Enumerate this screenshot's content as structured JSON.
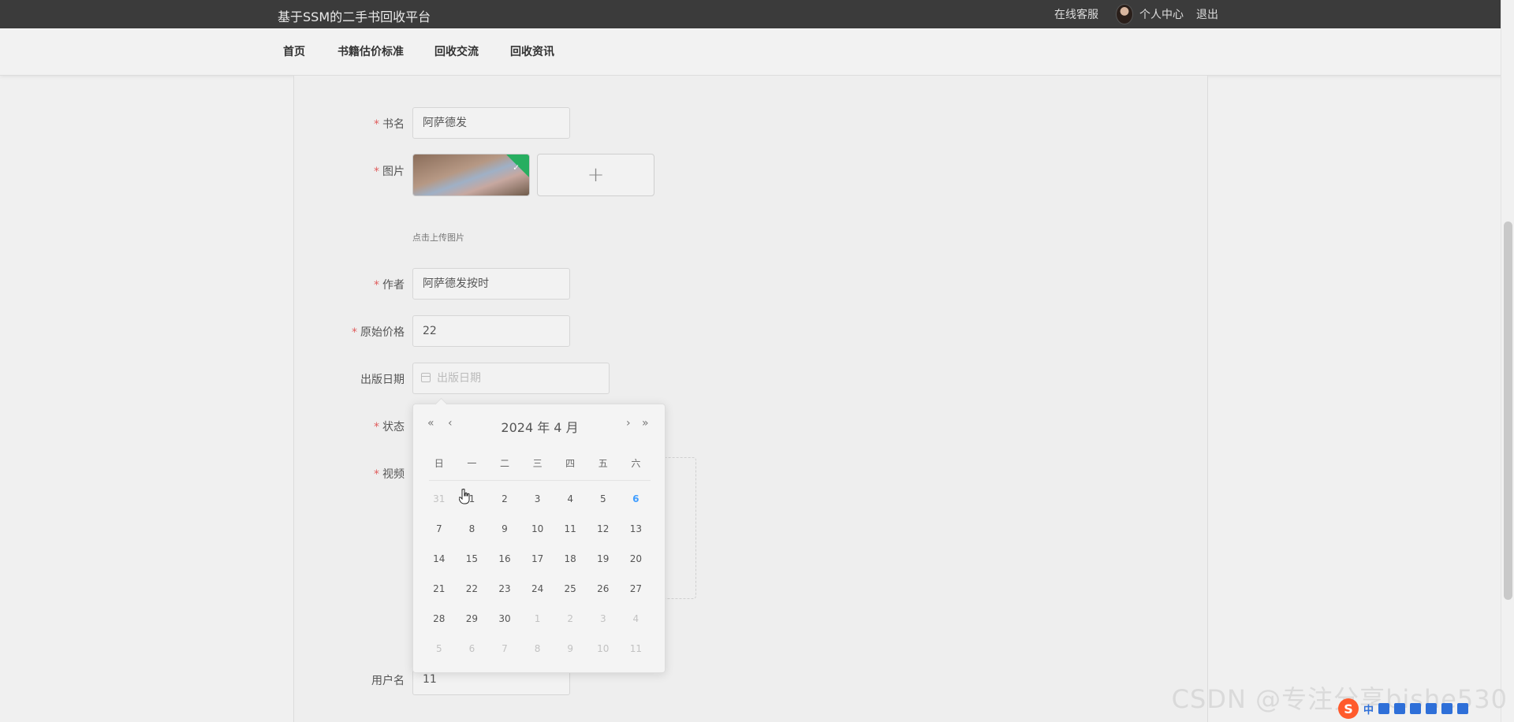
{
  "header": {
    "site_title": "基于SSM的二手书回收平台",
    "online_service": "在线客服",
    "personal_center": "个人中心",
    "logout": "退出"
  },
  "nav": {
    "items": [
      "首页",
      "书籍估价标准",
      "回收交流",
      "回收资讯"
    ]
  },
  "form": {
    "book_name": {
      "label": "书名",
      "value": "阿萨德发",
      "required": true
    },
    "image": {
      "label": "图片",
      "required": true,
      "add_symbol": "+",
      "tip": "点击上传图片"
    },
    "author": {
      "label": "作者",
      "value": "阿萨德发按时",
      "required": true
    },
    "original_price": {
      "label": "原始价格",
      "value": "22",
      "required": true
    },
    "publish_date": {
      "label": "出版日期",
      "placeholder": "出版日期"
    },
    "status": {
      "label": "状态",
      "required": true
    },
    "video": {
      "label": "视频",
      "required": true
    },
    "username": {
      "label": "用户名",
      "value": "11"
    }
  },
  "datepicker": {
    "title": "2024 年  4 月",
    "prev_year": "«",
    "prev_month": "‹",
    "next_month": "›",
    "next_year": "»",
    "weekdays": [
      "日",
      "一",
      "二",
      "三",
      "四",
      "五",
      "六"
    ],
    "today": "6",
    "days": [
      [
        "31",
        "1",
        "2",
        "3",
        "4",
        "5",
        "6"
      ],
      [
        "7",
        "8",
        "9",
        "10",
        "11",
        "12",
        "13"
      ],
      [
        "14",
        "15",
        "16",
        "17",
        "18",
        "19",
        "20"
      ],
      [
        "21",
        "22",
        "23",
        "24",
        "25",
        "26",
        "27"
      ],
      [
        "28",
        "29",
        "30",
        "1",
        "2",
        "3",
        "4"
      ],
      [
        "5",
        "6",
        "7",
        "8",
        "9",
        "10",
        "11"
      ]
    ]
  },
  "watermark": "CSDN @专注分享bishe530",
  "ime": {
    "logo": "S",
    "lang": "中"
  }
}
